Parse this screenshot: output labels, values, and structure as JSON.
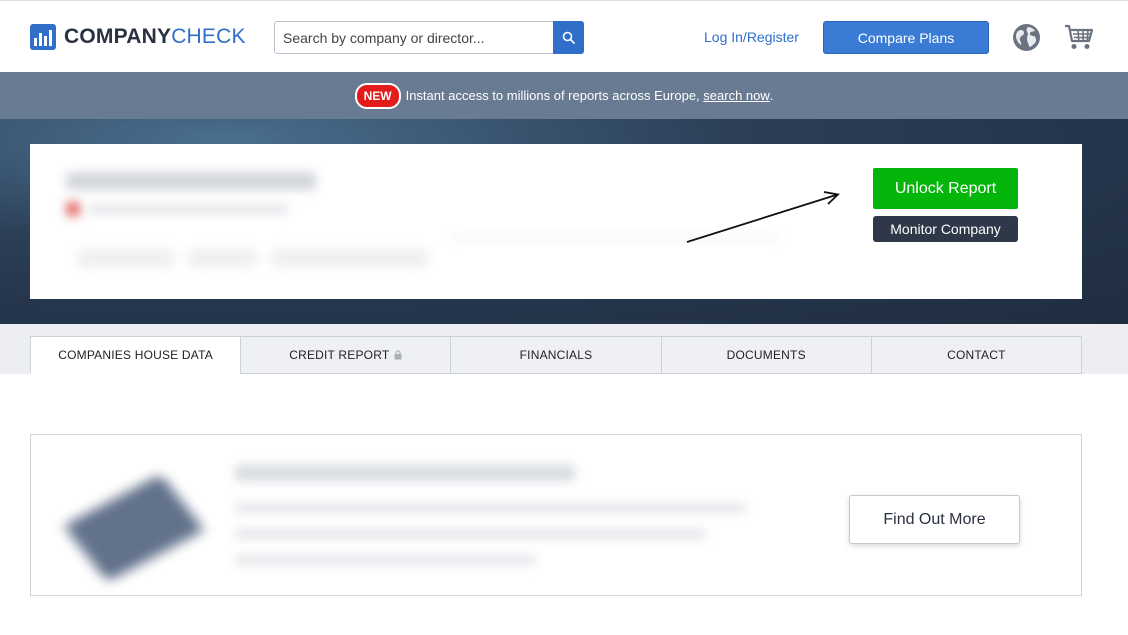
{
  "header": {
    "logo": {
      "bold": "COMPANY",
      "light": "CHECK"
    },
    "search": {
      "placeholder": "Search by company or director..."
    },
    "login_label": "Log In/Register",
    "compare_label": "Compare Plans"
  },
  "announcement": {
    "badge": "NEW",
    "text": "Instant access to millions of reports across Europe,",
    "link": "search now",
    "suffix": "."
  },
  "hero": {
    "unlock_label": "Unlock Report",
    "monitor_label": "Monitor Company"
  },
  "tabs": [
    {
      "label": "COMPANIES HOUSE DATA",
      "active": true
    },
    {
      "label": "CREDIT REPORT",
      "locked": true
    },
    {
      "label": "FINANCIALS"
    },
    {
      "label": "DOCUMENTS"
    },
    {
      "label": "CONTACT"
    }
  ],
  "promo": {
    "button_label": "Find Out More"
  },
  "colors": {
    "brand_blue": "#2f6fc9",
    "unlock_green": "#05b60a",
    "announce_bg": "#687b92",
    "new_badge_red": "#e31b1b"
  }
}
